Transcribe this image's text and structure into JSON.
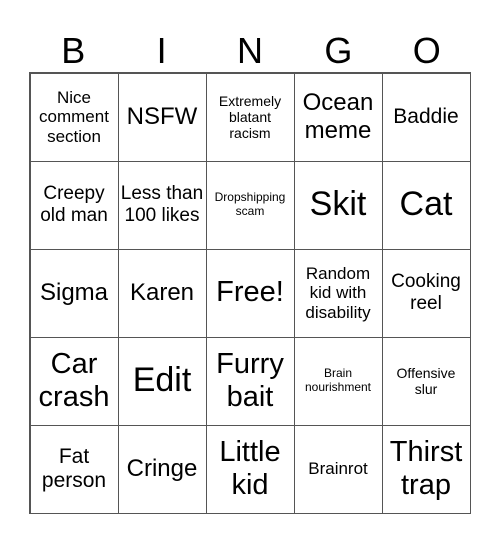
{
  "header": {
    "letters": [
      "B",
      "I",
      "N",
      "G",
      "O"
    ]
  },
  "board": {
    "rows": [
      [
        "Nice comment section",
        "NSFW",
        "Extremely blatant racism",
        "Ocean meme",
        "Baddie"
      ],
      [
        "Creepy old man",
        "Less than 100 likes",
        "Dropshipping scam",
        "Skit",
        "Cat"
      ],
      [
        "Sigma",
        "Karen",
        "Free!",
        "Random kid with disability",
        "Cooking reel"
      ],
      [
        "Car crash",
        "Edit",
        "Furry bait",
        "Brain nourishment",
        "Offensive slur"
      ],
      [
        "Fat person",
        "Cringe",
        "Little kid",
        "Brainrot",
        "Thirst trap"
      ]
    ]
  }
}
